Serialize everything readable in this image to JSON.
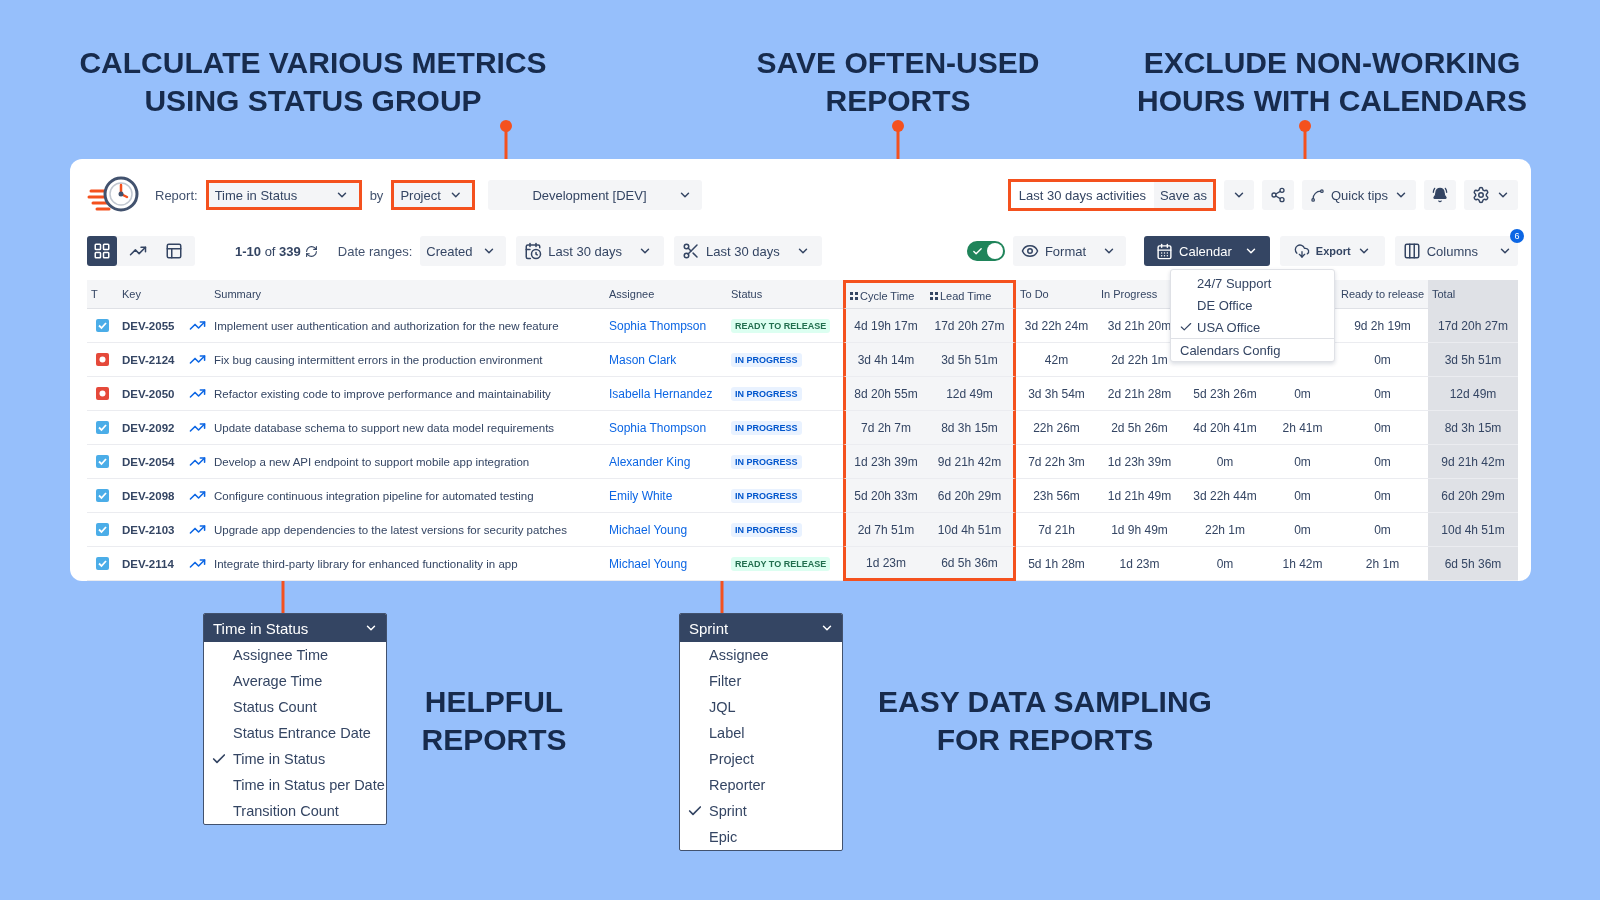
{
  "headlines_top": [
    {
      "lines": [
        "CALCULATE VARIOUS METRICS",
        "USING STATUS GROUP"
      ]
    },
    {
      "lines": [
        "SAVE OFTEN-USED",
        "REPORTS"
      ]
    },
    {
      "lines": [
        "EXCLUDE NON-WORKING",
        "HOURS WITH CALENDARS"
      ]
    }
  ],
  "toolbar": {
    "report_label": "Report:",
    "report_select": {
      "value": "Time in Status",
      "highlighted": true
    },
    "by_label": "by",
    "by_select": {
      "value": "Project",
      "highlighted": true
    },
    "project_select": {
      "value": "Development [DEV]"
    },
    "saved_report": {
      "name": "Last 30 days activities",
      "save_button": "Save as",
      "highlighted": true
    },
    "quick_tips": "Quick tips"
  },
  "view_bar": {
    "views": [
      {
        "kind": "grid",
        "selected": true
      },
      {
        "kind": "chart",
        "selected": false
      },
      {
        "kind": "panel",
        "selected": false
      }
    ],
    "count": "**1-10** of **339**",
    "date_ranges_label": "Date ranges:",
    "date_field": "Created",
    "ranges": [
      {
        "kind": "calendar",
        "label": "Last 30 days"
      },
      {
        "kind": "scissors",
        "label": "Last 30 days"
      }
    ],
    "toggle": {
      "on": true
    },
    "format": "Format",
    "calendar": "Calendar",
    "export": "Export",
    "columns": "Columns",
    "columns_badge": "6"
  },
  "calendar_menu": {
    "items": [
      {
        "label": "24/7 Support",
        "checked": false
      },
      {
        "label": "DE Office",
        "checked": false
      },
      {
        "label": "USA Office",
        "checked": true
      }
    ],
    "config": "Calendars Config"
  },
  "table": {
    "columns": [
      {
        "label": "T",
        "kind": "plain"
      },
      {
        "label": "Key",
        "kind": "plain"
      },
      {
        "label": "Summary",
        "kind": "plain"
      },
      {
        "label": "Assignee",
        "kind": "plain"
      },
      {
        "label": "Status",
        "kind": "plain"
      },
      {
        "label": "Cycle Time",
        "kind": "metric",
        "highlighted": true
      },
      {
        "label": "Lead Time",
        "kind": "metric",
        "highlighted": true
      },
      {
        "label": "To Do",
        "kind": "plain"
      },
      {
        "label": "In Progress",
        "kind": "plain"
      }
    ],
    "columns_right": [
      {
        "label": "Ready to release",
        "kind": "plain"
      },
      {
        "label": "Total",
        "kind": "total"
      }
    ],
    "rows": [
      {
        "kind": "task",
        "key": "DEV-2055",
        "summary": "Implement user authentication and authorization for the new feature",
        "assignee": "Sophia Thompson",
        "status": {
          "label": "READY TO RELEASE",
          "kind": "ready"
        },
        "times": [
          "4d 19h 17m",
          "17d 20h 27m",
          "3d 22h 24m",
          "3d 21h 20m"
        ],
        "times_right": [
          "9d 2h 19m",
          "17d 20h 27m"
        ]
      },
      {
        "kind": "bug",
        "key": "DEV-2124",
        "summary": "Fix bug causing intermittent errors in the production environment",
        "assignee": "Mason Clark",
        "status": {
          "label": "IN PROGRESS",
          "kind": "progress"
        },
        "times": [
          "3d 4h 14m",
          "3d 5h 51m",
          "42m",
          "2d 22h 1m"
        ],
        "times_right": [
          "0m",
          "3d 5h 51m"
        ]
      },
      {
        "kind": "bug",
        "key": "DEV-2050",
        "summary": "Refactor existing code to improve performance and maintainability",
        "assignee": "Isabella Hernandez",
        "status": {
          "label": "IN PROGRESS",
          "kind": "progress"
        },
        "times": [
          "8d 20h 55m",
          "12d 49m",
          "3d 3h 54m",
          "2d 21h 28m"
        ],
        "times_right": [
          "5d 23h 26m",
          "0m",
          "0m",
          "12d 49m"
        ]
      },
      {
        "kind": "task",
        "key": "DEV-2092",
        "summary": "Update database schema to support new data model requirements",
        "assignee": "Sophia Thompson",
        "status": {
          "label": "IN PROGRESS",
          "kind": "progress"
        },
        "times": [
          "7d 2h 7m",
          "8d 3h 15m",
          "22h 26m",
          "2d 5h 26m"
        ],
        "times_right": [
          "4d 20h 41m",
          "2h 41m",
          "0m",
          "8d 3h 15m"
        ]
      },
      {
        "kind": "task",
        "key": "DEV-2054",
        "summary": "Develop a new API endpoint to support mobile app integration",
        "assignee": "Alexander King",
        "status": {
          "label": "IN PROGRESS",
          "kind": "progress"
        },
        "times": [
          "1d 23h 39m",
          "9d 21h 42m",
          "7d 22h 3m",
          "1d 23h 39m"
        ],
        "times_right": [
          "0m",
          "0m",
          "0m",
          "9d 21h 42m"
        ]
      },
      {
        "kind": "task",
        "key": "DEV-2098",
        "summary": "Configure continuous integration pipeline for automated testing",
        "assignee": "Emily White",
        "status": {
          "label": "IN PROGRESS",
          "kind": "progress"
        },
        "times": [
          "5d 20h 33m",
          "6d 20h 29m",
          "23h 56m",
          "1d 21h 49m"
        ],
        "times_right": [
          "3d 22h 44m",
          "0m",
          "0m",
          "6d 20h 29m"
        ]
      },
      {
        "kind": "task",
        "key": "DEV-2103",
        "summary": "Upgrade app dependencies to the latest versions for security patches",
        "assignee": "Michael Young",
        "status": {
          "label": "IN PROGRESS",
          "kind": "progress"
        },
        "times": [
          "2d 7h 51m",
          "10d 4h 51m",
          "7d 21h",
          "1d 9h 49m"
        ],
        "times_right": [
          "22h 1m",
          "0m",
          "0m",
          "10d 4h 51m"
        ]
      },
      {
        "kind": "task",
        "key": "DEV-2114",
        "summary": "Integrate third-party library for enhanced functionality in app",
        "assignee": "Michael Young",
        "status": {
          "label": "READY TO RELEASE",
          "kind": "ready"
        },
        "times": [
          "1d 23m",
          "6d 5h 36m",
          "5d 1h 28m",
          "1d 23m"
        ],
        "times_right": [
          "0m",
          "1h 42m",
          "2h 1m",
          "6d 5h 36m"
        ]
      }
    ]
  },
  "report_menu": {
    "value": "Time in Status",
    "items": [
      {
        "label": "Assignee Time",
        "checked": false
      },
      {
        "label": "Average Time",
        "checked": false
      },
      {
        "label": "Status Count",
        "checked": false
      },
      {
        "label": "Status Entrance Date",
        "checked": false
      },
      {
        "label": "Time in Status",
        "checked": true
      },
      {
        "label": "Time in Status per Date",
        "checked": false
      },
      {
        "label": "Transition Count",
        "checked": false
      }
    ]
  },
  "headline_reports": {
    "lines": [
      "HELPFUL",
      "REPORTS"
    ]
  },
  "group_menu": {
    "value": "Sprint",
    "items": [
      {
        "label": "Assignee",
        "checked": false
      },
      {
        "label": "Filter",
        "checked": false
      },
      {
        "label": "JQL",
        "checked": false
      },
      {
        "label": "Label",
        "checked": false
      },
      {
        "label": "Project",
        "checked": false
      },
      {
        "label": "Reporter",
        "checked": false
      },
      {
        "label": "Sprint",
        "checked": true
      },
      {
        "label": "Epic",
        "checked": false
      }
    ]
  },
  "headline_sampling": {
    "lines": [
      "EASY DATA SAMPLING",
      "FOR REPORTS"
    ]
  }
}
